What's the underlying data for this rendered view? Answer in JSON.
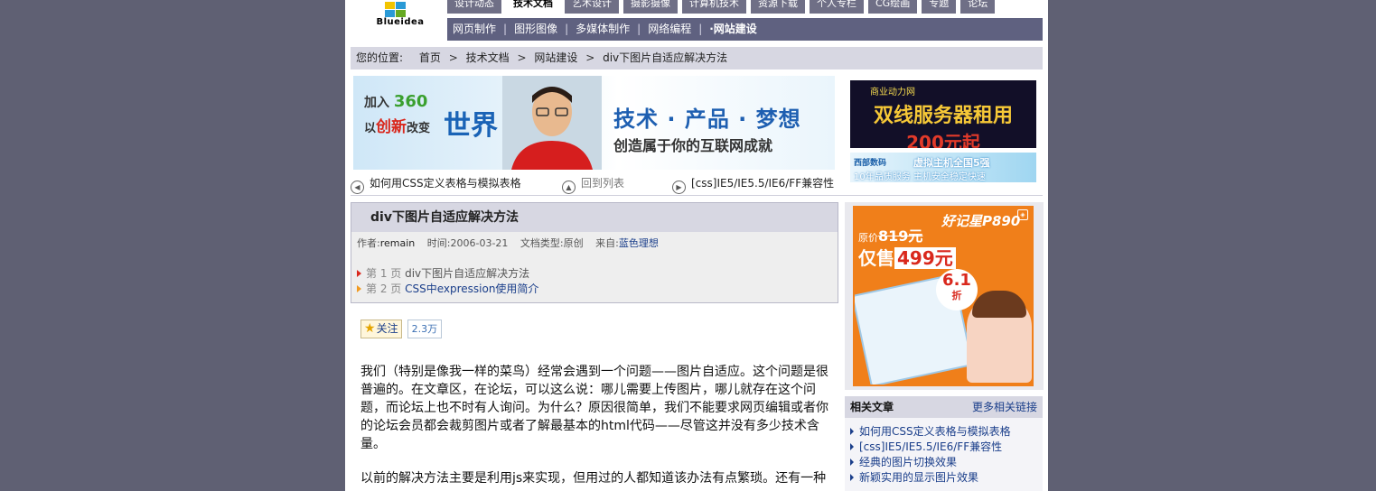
{
  "header": {
    "logo_text": "Blueidea",
    "top_tabs": [
      "设计动态",
      "技术文档",
      "艺术设计",
      "摄影摄像",
      "计算机技术",
      "资源下载",
      "个人专栏",
      "CG绘画",
      "专题",
      "论坛"
    ],
    "sub_nav": [
      "网页制作",
      "图形图像",
      "多媒体制作",
      "网络编程",
      "·网站建设"
    ]
  },
  "breadcrumb": {
    "label": "您的位置:",
    "items": [
      "首页",
      "技术文档",
      "网站建设",
      "div下图片自适应解决方法"
    ]
  },
  "banner": {
    "join": "加入",
    "join_num": "360",
    "line2_prefix": "以",
    "line2_hl": "创新",
    "line2_suffix": "改变",
    "world": "世界",
    "slogan": "技术 · 产品 · 梦想",
    "slogan2": "创造属于你的互联网成就"
  },
  "ad_top": {
    "ad1_a": "商业动力网",
    "ad1_b": "双线服务器租用",
    "ad1_c": "200元起",
    "ad2_left": "西部数码",
    "ad2_right": "虚拟主机全国5强",
    "ad2_bottom": "10年品质服务 主机安全稳定快速"
  },
  "pager": {
    "prev": "如何用CSS定义表格与模拟表格",
    "list": "回到列表",
    "next": "[css]IE5/IE5.5/IE6/FF兼容性"
  },
  "article": {
    "title": "div下图片自适应解决方法",
    "author_label": "作者:",
    "author": "remain",
    "time_label": "时间:",
    "time": "2006-03-21",
    "type_label": "文档类型:",
    "type": "原创",
    "source_label": "来自:",
    "source": "蓝色理想",
    "pages": [
      {
        "num": "第 1 页",
        "title": "div下图片自适应解决方法"
      },
      {
        "num": "第 2 页",
        "title": "CSS中expression使用简介"
      }
    ],
    "follow_label": "关注",
    "follow_count": "2.3万",
    "para1": "我们（特别是像我一样的菜鸟）经常会遇到一个问题——图片自适应。这个问题是很普遍的。在文章区，在论坛，可以这么说：哪儿需要上传图片，哪儿就存在这个问题，而论坛上也不时有人询问。为什么？原因很简单，我们不能要求网页编辑或者你的论坛会员都会裁剪图片或者了解最基本的html代码——尽管这并没有多少技术含量。",
    "para2": "以前的解决方法主要是利用js来实现，但用过的人都知道该办法有点繁琐。还有一种"
  },
  "side_ad": {
    "price_label": "原价",
    "old_price": "819元",
    "sale_label": "仅售",
    "sale_price": "499元",
    "brand": "好记星P890",
    "discount": "6.1",
    "discount_unit": "折"
  },
  "related": {
    "title": "相关文章",
    "more": "更多相关链接",
    "items": [
      "如何用CSS定义表格与模拟表格",
      "[css]IE5/IE5.5/IE6/FF兼容性",
      "经典的图片切换效果",
      "新颖实用的显示图片效果"
    ]
  },
  "colors": {
    "page_bg": "#5f6073",
    "nav_tab": "#6f6f86",
    "sub_nav": "#5f6180",
    "crumb_bg": "#d7d7e2",
    "link": "#1a3e8a"
  }
}
